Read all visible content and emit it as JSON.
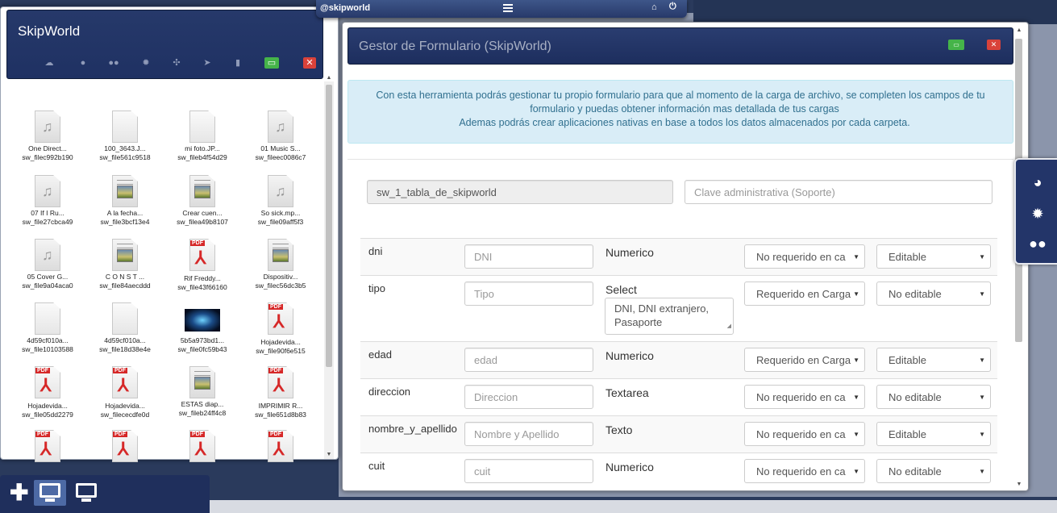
{
  "topbar": {
    "brand": "@skipworld",
    "menu_icon": "hamburger-icon",
    "home_icon": "home-icon",
    "power_icon": "power-icon"
  },
  "left_window": {
    "title": "SkipWorld",
    "toolbar": [
      "cloud-upload-icon",
      "user-icon",
      "users-icon",
      "gear-icon",
      "crosshair-icon",
      "send-icon",
      "trash-icon",
      "monitor-icon",
      "close-icon"
    ],
    "files": [
      {
        "name": "One Direct...",
        "id": "sw_filec992b190",
        "kind": "audio"
      },
      {
        "name": "100_3643.J...",
        "id": "sw_file561c9518",
        "kind": "blank"
      },
      {
        "name": "mi foto.JP...",
        "id": "sw_fileb4f54d29",
        "kind": "blank"
      },
      {
        "name": "01 Music S...",
        "id": "sw_fileec0086c7",
        "kind": "audio"
      },
      {
        "name": "07 If I Ru...",
        "id": "sw_file27cbca49",
        "kind": "audio"
      },
      {
        "name": "A la fecha...",
        "id": "sw_file3bcf13e4",
        "kind": "image-doc"
      },
      {
        "name": "Crear cuen...",
        "id": "sw_filea49b8107",
        "kind": "image-doc"
      },
      {
        "name": "So sick.mp...",
        "id": "sw_file09aff5f3",
        "kind": "audio"
      },
      {
        "name": "05 Cover G...",
        "id": "sw_file9a04aca0",
        "kind": "audio"
      },
      {
        "name": "C O N S T ...",
        "id": "sw_file84aecddd",
        "kind": "image-doc"
      },
      {
        "name": "Rif Freddy...",
        "id": "sw_file43f66160",
        "kind": "pdf"
      },
      {
        "name": "Dispositiv...",
        "id": "sw_filec56dc3b5",
        "kind": "image-doc"
      },
      {
        "name": "4d59cf010a...",
        "id": "sw_file10103588",
        "kind": "blank"
      },
      {
        "name": "4d59cf010a...",
        "id": "sw_file18d38e4e",
        "kind": "blank"
      },
      {
        "name": "5b5a973bd1...",
        "id": "sw_file0fc59b43",
        "kind": "picture"
      },
      {
        "name": "Hojadevida...",
        "id": "sw_file90f6e515",
        "kind": "pdf"
      },
      {
        "name": "Hojadevida...",
        "id": "sw_file05dd2279",
        "kind": "pdf"
      },
      {
        "name": "Hojadevida...",
        "id": "sw_filececdfe0d",
        "kind": "pdf"
      },
      {
        "name": "ESTAS diap...",
        "id": "sw_fileb24ff4c8",
        "kind": "image-doc"
      },
      {
        "name": "IMPRIMIR R...",
        "id": "sw_file651d8b83",
        "kind": "pdf"
      },
      {
        "name": "",
        "id": "",
        "kind": "pdf"
      },
      {
        "name": "",
        "id": "",
        "kind": "pdf"
      },
      {
        "name": "",
        "id": "",
        "kind": "pdf"
      },
      {
        "name": "",
        "id": "",
        "kind": "pdf"
      }
    ]
  },
  "main_window": {
    "title": "Gestor de Formulario (SkipWorld)",
    "info_line1": "Con esta herramienta podrás gestionar tu propio formulario para que al momento de la carga de archivo, se completen los campos de tu",
    "info_line2": "formulario y puedas obtener información mas detallada de tus cargas",
    "info_line3": "Ademas podrás crear aplicaciones nativas en base a todos los datos almacenados por cada carpeta.",
    "table_name": "sw_1_tabla_de_skipworld",
    "admin_key_placeholder": "Clave administrativa (Soporte)",
    "fields": [
      {
        "name": "dni",
        "placeholder": "DNI",
        "type": "Numerico",
        "required": "No requerido en ca",
        "editable": "Editable"
      },
      {
        "name": "tipo",
        "placeholder": "Tipo",
        "type": "Select",
        "options_text": "DNI, DNI extranjero, Pasaporte",
        "required": "Requerido en Carga",
        "editable": "No editable"
      },
      {
        "name": "edad",
        "placeholder": "edad",
        "type": "Numerico",
        "required": "Requerido en Carga",
        "editable": "Editable"
      },
      {
        "name": "direccion",
        "placeholder": "Direccion",
        "type": "Textarea",
        "required": "No requerido en ca",
        "editable": "No editable"
      },
      {
        "name": "nombre_y_apellido",
        "placeholder": "Nombre y Apellido",
        "type": "Texto",
        "required": "No requerido en ca",
        "editable": "Editable"
      },
      {
        "name": "cuit",
        "placeholder": "cuit",
        "type": "Numerico",
        "required": "No requerido en ca",
        "editable": "No editable"
      }
    ]
  },
  "side_panel": [
    "globe-icon",
    "gear-icon",
    "users-icon"
  ],
  "dock": [
    "add-icon",
    "monitor-icon",
    "monitor-icon"
  ]
}
